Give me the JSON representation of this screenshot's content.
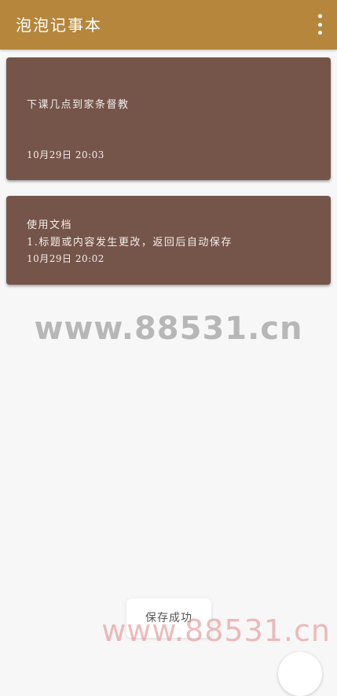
{
  "app": {
    "title": "泡泡记事本",
    "menu_icon": "more-vertical-icon"
  },
  "notes": [
    {
      "content": "下课几点到家条督教",
      "date": "10月29日  20:03"
    },
    {
      "content": "使用文档\n1.标题或内容发生更改，返回后自动保存",
      "date": "10月29日  20:02"
    }
  ],
  "toast": {
    "message": "保存成功"
  },
  "watermarks": {
    "center": "www.88531.cn",
    "bottom": "www.88531.cn"
  },
  "colors": {
    "appbar": "#b5863b",
    "card": "#75554a",
    "background": "#f7f7f7"
  }
}
